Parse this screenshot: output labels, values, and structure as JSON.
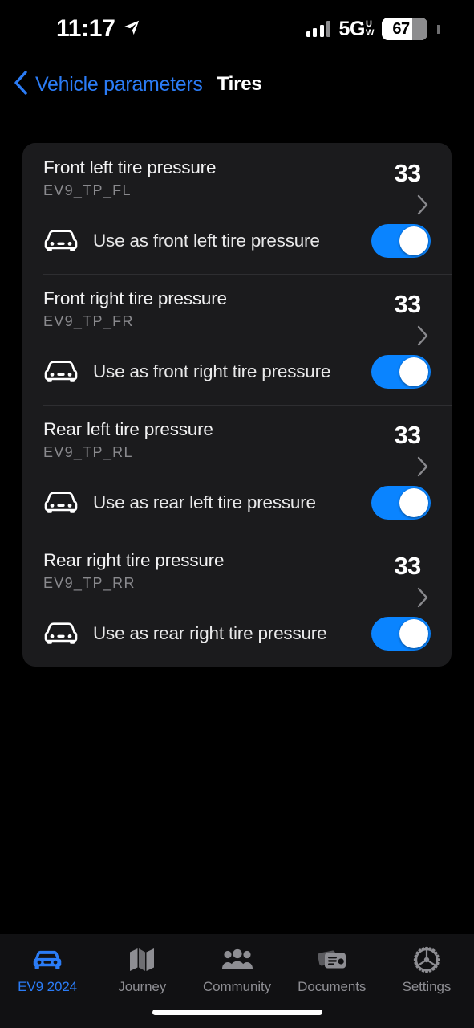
{
  "status_bar": {
    "time": "11:17",
    "location_icon": "location-arrow-icon",
    "signal_icon": "cellular-bars-icon",
    "network": "5G",
    "network_sup": "U",
    "network_sub": "W",
    "battery_percent": "67",
    "battery_level": 67
  },
  "nav": {
    "back_icon": "chevron-left-icon",
    "back_label": "Vehicle parameters",
    "title": "Tires"
  },
  "colors": {
    "accent_blue": "#2b7cf6",
    "toggle_blue": "#0a84ff",
    "card_bg": "#1b1b1d",
    "page_bg": "#000000",
    "muted_text": "#8a8a8e"
  },
  "rows": [
    {
      "title": "Front left tire pressure",
      "code": "EV9_TP_FL",
      "value": "33",
      "chevron_icon": "chevron-right-icon",
      "car_icon": "car-front-icon",
      "toggle_label": "Use as front left tire pressure",
      "toggle_on": true
    },
    {
      "title": "Front right tire pressure",
      "code": "EV9_TP_FR",
      "value": "33",
      "chevron_icon": "chevron-right-icon",
      "car_icon": "car-front-icon",
      "toggle_label": "Use as front right tire pressure",
      "toggle_on": true
    },
    {
      "title": "Rear left tire pressure",
      "code": "EV9_TP_RL",
      "value": "33",
      "chevron_icon": "chevron-right-icon",
      "car_icon": "car-front-icon",
      "toggle_label": "Use as rear left tire pressure",
      "toggle_on": true
    },
    {
      "title": "Rear right tire pressure",
      "code": "EV9_TP_RR",
      "value": "33",
      "chevron_icon": "chevron-right-icon",
      "car_icon": "car-front-icon",
      "toggle_label": "Use as rear right tire pressure",
      "toggle_on": true
    }
  ],
  "tabs": [
    {
      "label": "EV9 2024",
      "icon": "car-front-icon",
      "active": true
    },
    {
      "label": "Journey",
      "icon": "map-icon",
      "active": false
    },
    {
      "label": "Community",
      "icon": "people-icon",
      "active": false
    },
    {
      "label": "Documents",
      "icon": "cards-icon",
      "active": false
    },
    {
      "label": "Settings",
      "icon": "gear-icon",
      "active": false
    }
  ]
}
